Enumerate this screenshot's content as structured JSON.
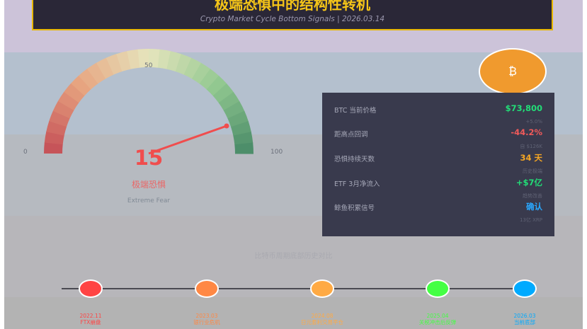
{
  "header": {
    "title": "极端恐惧中的结构性转机",
    "subtitle": "Crypto Market Cycle Bottom Signals | 2026.03.14"
  },
  "gauge": {
    "value": 15,
    "value_text": "15",
    "min_label": "0",
    "mid_label": "50",
    "max_label": "100",
    "label_cn": "极端恐惧",
    "label_en": "Extreme Fear",
    "needle_color": "#f04d4d"
  },
  "coin": {
    "symbol": "₿",
    "color": "#f09a2e"
  },
  "stats": [
    {
      "label": "BTC 当前价格",
      "value": "$73,800",
      "sub": "+5.0%",
      "color": "#22dd77"
    },
    {
      "label": "距高点回调",
      "value": "-44.2%",
      "sub": "自 $126K",
      "color": "#f05a5a"
    },
    {
      "label": "恐惧持续天数",
      "value": "34 天",
      "sub": "历史极端",
      "color": "#f5a623"
    },
    {
      "label": "ETF 3月净流入",
      "value": "+$7亿",
      "sub": "趋势改善",
      "color": "#22dd77"
    },
    {
      "label": "鲸鱼积累信号",
      "value": "确认",
      "sub": "13亿 XRP",
      "color": "#29a8ff"
    }
  ],
  "timeline": {
    "title": "比特币周期底部历史对比",
    "events": [
      {
        "date": "2022.11",
        "name": "FTX崩盘",
        "color": "#ff4444"
      },
      {
        "date": "2023.03",
        "name": "银行业危机",
        "color": "#ff8844"
      },
      {
        "date": "2024.08",
        "name": "日元套利交易平仓",
        "color": "#ffaa44"
      },
      {
        "date": "2025.04",
        "name": "关税冲击后反弹",
        "color": "#44ff44"
      },
      {
        "date": "2026.03",
        "name": "当前底部",
        "color": "#00aaff"
      }
    ]
  }
}
